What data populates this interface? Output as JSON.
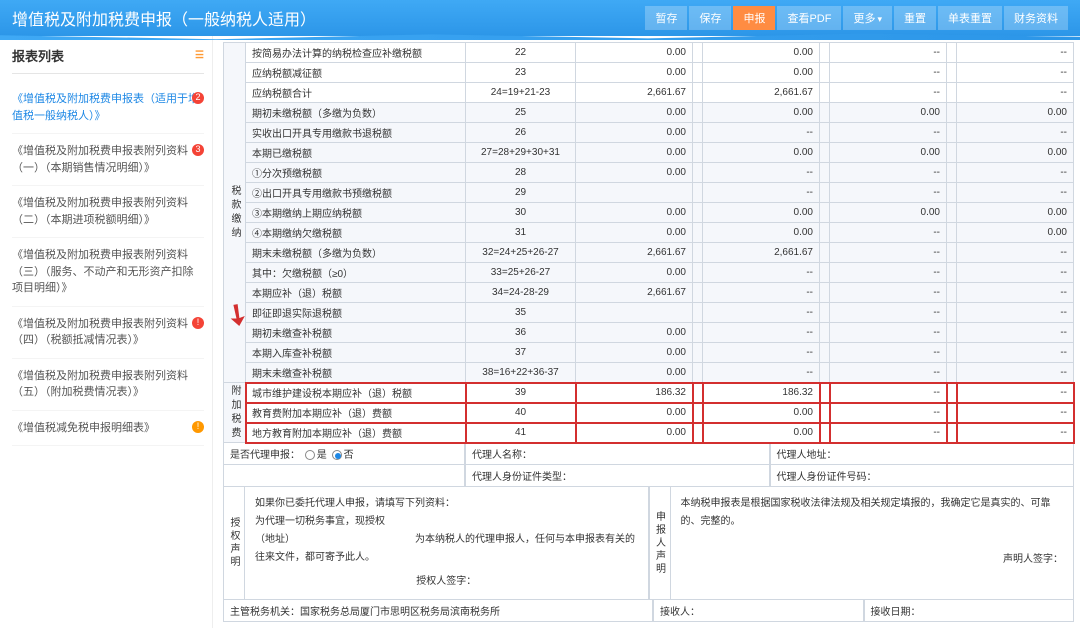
{
  "header": {
    "title": "增值税及附加税费申报（一般纳税人适用）",
    "btns": [
      {
        "k": "temp",
        "t": "暂存"
      },
      {
        "k": "save",
        "t": "保存"
      },
      {
        "k": "submit",
        "t": "申报"
      },
      {
        "k": "pdf",
        "t": "查看PDF"
      },
      {
        "k": "more",
        "t": "更多"
      },
      {
        "k": "reset",
        "t": "重置"
      },
      {
        "k": "reset1",
        "t": "单表重置"
      },
      {
        "k": "fin",
        "t": "财务资料"
      }
    ]
  },
  "sidebar": {
    "title": "报表列表",
    "items": [
      {
        "t": "《增值税及附加税费申报表（适用于增值税一般纳税人）》",
        "badge": "2",
        "cls": "cur"
      },
      {
        "t": "《增值税及附加税费申报表附列资料（一）（本期销售情况明细）》",
        "badge": "3"
      },
      {
        "t": "《增值税及附加税费申报表附列资料（二）（本期进项税额明细）》"
      },
      {
        "t": "《增值税及附加税费申报表附列资料（三）（服务、不动产和无形资产扣除项目明细）》"
      },
      {
        "t": "《增值税及附加税费申报表附列资料（四）（税额抵减情况表）》",
        "badge": "!",
        "warn": false
      },
      {
        "t": "《增值税及附加税费申报表附列资料（五）（附加税费情况表）》"
      },
      {
        "t": "《增值税减免税申报明细表》",
        "badge": "!",
        "warn": true
      }
    ]
  },
  "sections": {
    "tax": "税款缴纳",
    "add": "附加税费"
  },
  "rows": [
    {
      "sec": "tax",
      "lbl": "按简易办法计算的纳税检查应补缴税额",
      "no": "22",
      "c": [
        "0.00",
        "",
        "0.00",
        "",
        "--",
        "",
        "--"
      ]
    },
    {
      "sec": "tax",
      "lbl": "应纳税额减征额",
      "no": "23",
      "c": [
        "0.00",
        "",
        "0.00",
        "",
        "--",
        "",
        "--"
      ]
    },
    {
      "sec": "tax",
      "lbl": "应纳税额合计",
      "no": "24=19+21-23",
      "c": [
        "2,661.67",
        "",
        "2,661.67",
        "",
        "--",
        "",
        "--"
      ]
    },
    {
      "sec": "tax",
      "lbl": "期初未缴税额（多缴为负数）",
      "no": "25",
      "c": [
        "0.00",
        "",
        "0.00",
        "",
        "0.00",
        "",
        "0.00"
      ],
      "sh": 1
    },
    {
      "sec": "tax",
      "lbl": "实收出口开具专用缴款书退税额",
      "no": "26",
      "c": [
        "0.00",
        "",
        "--",
        "",
        "--",
        "",
        "--"
      ],
      "sh": 1
    },
    {
      "sec": "tax",
      "lbl": "本期已缴税额",
      "no": "27=28+29+30+31",
      "c": [
        "0.00",
        "",
        "0.00",
        "",
        "0.00",
        "",
        "0.00"
      ],
      "sh": 1
    },
    {
      "sec": "tax",
      "lbl": "①分次预缴税额",
      "no": "28",
      "c": [
        "0.00",
        "",
        "--",
        "",
        "--",
        "",
        "--"
      ],
      "sh": 1
    },
    {
      "sec": "tax",
      "lbl": "②出口开具专用缴款书预缴税额",
      "no": "29",
      "c": [
        "",
        "",
        "--",
        "",
        "--",
        "",
        "--"
      ],
      "sh": 1
    },
    {
      "sec": "tax",
      "lbl": "③本期缴纳上期应纳税额",
      "no": "30",
      "c": [
        "0.00",
        "",
        "0.00",
        "",
        "0.00",
        "",
        "0.00"
      ],
      "sh": 1
    },
    {
      "sec": "tax",
      "lbl": "④本期缴纳欠缴税额",
      "no": "31",
      "c": [
        "0.00",
        "",
        "0.00",
        "",
        "--",
        "",
        "0.00"
      ],
      "sh": 1
    },
    {
      "sec": "tax",
      "lbl": "期末未缴税额（多缴为负数）",
      "no": "32=24+25+26-27",
      "c": [
        "2,661.67",
        "",
        "2,661.67",
        "",
        "--",
        "",
        "--"
      ],
      "sh": 1
    },
    {
      "sec": "tax",
      "lbl": "其中：欠缴税额（≥0）",
      "no": "33=25+26-27",
      "c": [
        "0.00",
        "",
        "--",
        "",
        "--",
        "",
        "--"
      ],
      "sh": 1
    },
    {
      "sec": "tax",
      "lbl": "本期应补（退）税额",
      "no": "34=24-28-29",
      "c": [
        "2,661.67",
        "",
        "--",
        "",
        "--",
        "",
        "--"
      ],
      "sh": 1
    },
    {
      "sec": "tax",
      "lbl": "即征即退实际退税额",
      "no": "35",
      "c": [
        "",
        "",
        "--",
        "",
        "--",
        "",
        "--"
      ],
      "sh": 1
    },
    {
      "sec": "tax",
      "lbl": "期初未缴查补税额",
      "no": "36",
      "c": [
        "0.00",
        "",
        "--",
        "",
        "--",
        "",
        "--"
      ],
      "sh": 1
    },
    {
      "sec": "tax",
      "lbl": "本期入库查补税额",
      "no": "37",
      "c": [
        "0.00",
        "",
        "--",
        "",
        "--",
        "",
        "--"
      ],
      "sh": 1
    },
    {
      "sec": "tax",
      "lbl": "期末未缴查补税额",
      "no": "38=16+22+36-37",
      "c": [
        "0.00",
        "",
        "--",
        "",
        "--",
        "",
        "--"
      ],
      "sh": 1
    },
    {
      "sec": "add",
      "lbl": "城市维护建设税本期应补（退）税额",
      "no": "39",
      "c": [
        "186.32",
        "",
        "186.32",
        "",
        "--",
        "",
        "--"
      ],
      "hl": 1
    },
    {
      "sec": "add",
      "lbl": "教育费附加本期应补（退）费额",
      "no": "40",
      "c": [
        "0.00",
        "",
        "0.00",
        "",
        "--",
        "",
        "--"
      ],
      "hl": 1
    },
    {
      "sec": "add",
      "lbl": "地方教育附加本期应补（退）费额",
      "no": "41",
      "c": [
        "0.00",
        "",
        "0.00",
        "",
        "--",
        "",
        "--"
      ],
      "hl": 1
    }
  ],
  "footer": {
    "agentQ": "是否代理申报：",
    "yes": "是",
    "no": "否",
    "agentName": "代理人名称：",
    "agentAddr": "代理人地址：",
    "agentId": "代理人身份证件类型：",
    "agentIdNo": "代理人身份证件号码：",
    "auth": "授权声明",
    "decl": "申报人声明",
    "authText1": "如果你已委托代理人申报，请填写下列资料：",
    "authText2": "为代理一切税务事宜，现授权",
    "authText3": "（地址）",
    "authText4": "为本纳税人的代理申报人，任何与本申报表有关的往来文件，都可寄予此人。",
    "authSign": "授权人签字：",
    "declText": "本纳税申报表是根据国家税收法律法规及相关规定填报的，我确定它是真实的、可靠的、完整的。",
    "declSign": "声明人签字：",
    "orgLabel": "主管税务机关：",
    "org": "国家税务总局厦门市思明区税务局滨南税务所",
    "recv": "接收人：",
    "recvDate": "接收日期："
  }
}
